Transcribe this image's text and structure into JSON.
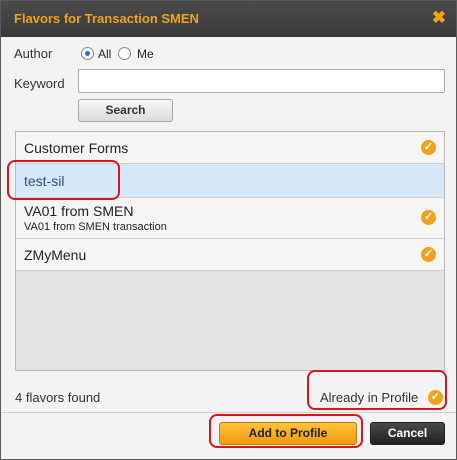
{
  "dialog": {
    "title": "Flavors for Transaction SMEN",
    "close_glyph": "✖"
  },
  "filters": {
    "author_label": "Author",
    "author_options": [
      {
        "label": "All",
        "selected": true
      },
      {
        "label": "Me",
        "selected": false
      }
    ],
    "keyword_label": "Keyword",
    "keyword_value": "",
    "search_label": "Search"
  },
  "flavors": [
    {
      "title": "Customer Forms",
      "subtitle": "",
      "in_profile": true,
      "selected": false
    },
    {
      "title": "test-sil",
      "subtitle": "",
      "in_profile": false,
      "selected": true
    },
    {
      "title": "VA01 from SMEN",
      "subtitle": "VA01 from SMEN transaction",
      "in_profile": true,
      "selected": false
    },
    {
      "title": "ZMyMenu",
      "subtitle": "",
      "in_profile": true,
      "selected": false
    }
  ],
  "status": {
    "count_text": "4 flavors found",
    "legend_text": "Already in Profile"
  },
  "buttons": {
    "add_label": "Add to Profile",
    "cancel_label": "Cancel"
  },
  "check_glyph": "✓",
  "colors": {
    "accent": "#f0a318",
    "check": "#f2a11b",
    "selected_row": "#d6e9f8",
    "annotation": "#d8141c"
  }
}
